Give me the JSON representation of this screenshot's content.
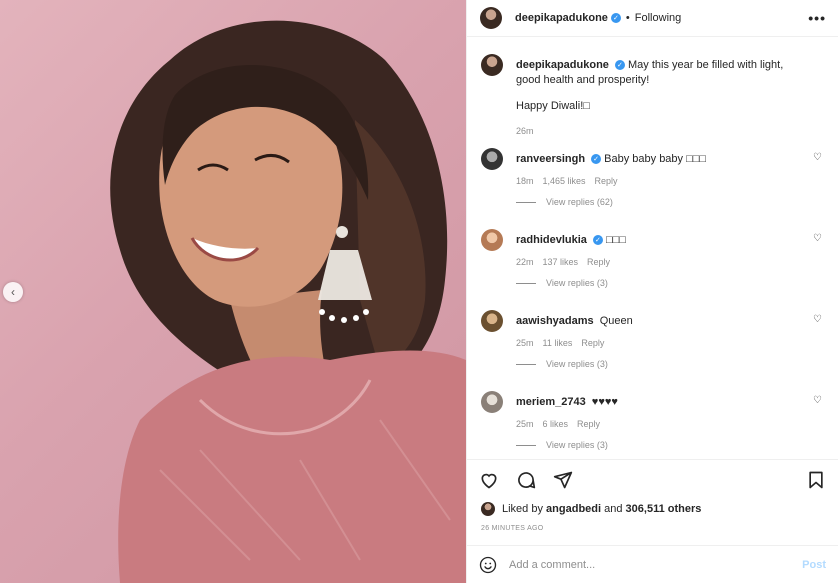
{
  "post": {
    "author": "deepikapadukone",
    "follow_status": "Following",
    "dot": "•",
    "more": "•••"
  },
  "caption": {
    "username": "deepikapadukone",
    "text": "May this year be filled with light, good health and prosperity!",
    "text2": "Happy Diwali!□",
    "time": "26m"
  },
  "comments": [
    {
      "username": "ranveersingh",
      "verified": true,
      "text": "Baby baby baby □□□",
      "time": "18m",
      "likes": "1,465 likes",
      "reply": "Reply",
      "replies": "View replies (62)"
    },
    {
      "username": "radhidevlukia",
      "verified": true,
      "text": "□□□",
      "time": "22m",
      "likes": "137 likes",
      "reply": "Reply",
      "replies": "View replies (3)"
    },
    {
      "username": "aawishyadams",
      "verified": false,
      "text": "Queen",
      "time": "25m",
      "likes": "11 likes",
      "reply": "Reply",
      "replies": "View replies (3)"
    },
    {
      "username": "meriem_2743",
      "verified": false,
      "text": "♥♥♥♥",
      "time": "25m",
      "likes": "6 likes",
      "reply": "Reply",
      "replies": "View replies (3)"
    }
  ],
  "likes": {
    "prefix": "Liked by",
    "user": "angadbedi",
    "and": "and",
    "others": "306,511 others"
  },
  "time_ago": "26 MINUTES AGO",
  "add_comment": {
    "placeholder": "Add a comment...",
    "post_label": "Post"
  },
  "icons": {
    "prev": "‹",
    "heart_small": "♡",
    "check": "✓"
  },
  "colors": {
    "accent": "#3897f0",
    "post_disabled": "#b3dbff",
    "photo_bg": "#dca6b1"
  }
}
